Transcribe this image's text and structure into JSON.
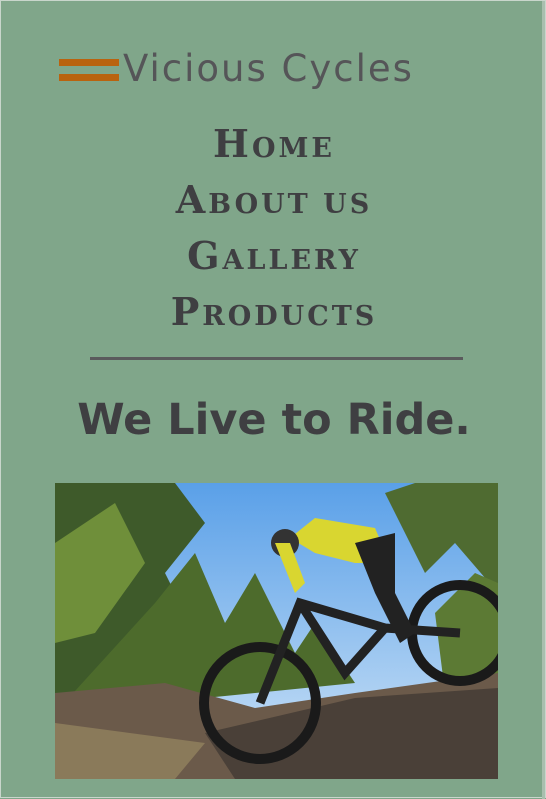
{
  "brand": {
    "name": "Vicious Cycles",
    "accent": "#b9630f"
  },
  "nav": {
    "items": [
      {
        "first": "H",
        "rest": "ome"
      },
      {
        "first": "A",
        "rest": "bout Us"
      },
      {
        "first": "G",
        "rest": "allery"
      },
      {
        "first": "P",
        "rest": "roducts"
      }
    ]
  },
  "tagline": "We Live to Ride.",
  "hero": {
    "icon": "mountain-bike-rider-photo"
  },
  "colors": {
    "background": "#80a68a",
    "text": "#3f3f42"
  }
}
